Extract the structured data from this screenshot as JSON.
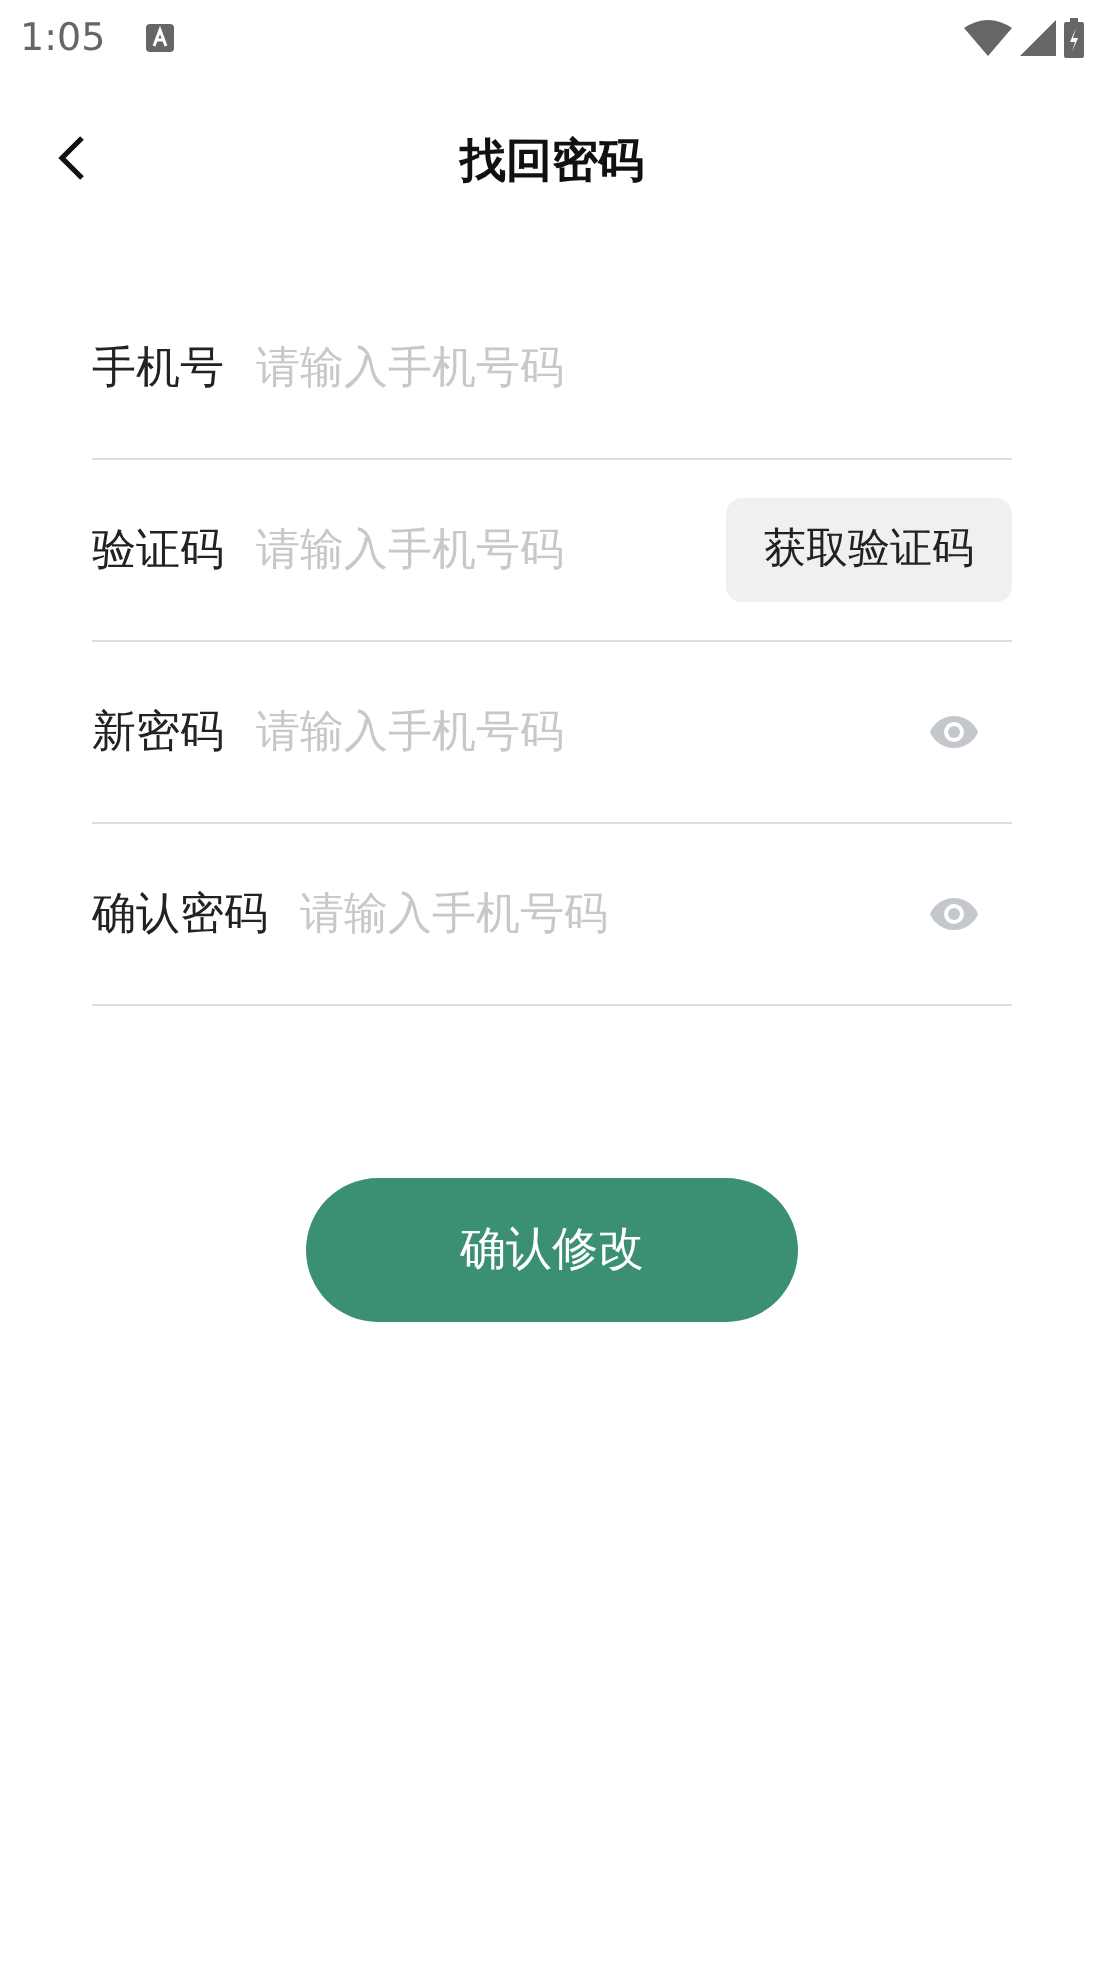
{
  "status_bar": {
    "time": "1:05"
  },
  "header": {
    "title": "找回密码"
  },
  "fields": [
    {
      "kind": "plain",
      "label": "手机号",
      "placeholder": "请输入手机号码"
    },
    {
      "kind": "code",
      "label": "验证码",
      "placeholder": "请输入手机号码",
      "button": "获取验证码"
    },
    {
      "kind": "password",
      "label": "新密码",
      "placeholder": "请输入手机号码"
    },
    {
      "kind": "password",
      "label": "确认密码",
      "placeholder": "请输入手机号码"
    }
  ],
  "submit": {
    "label": "确认修改"
  }
}
